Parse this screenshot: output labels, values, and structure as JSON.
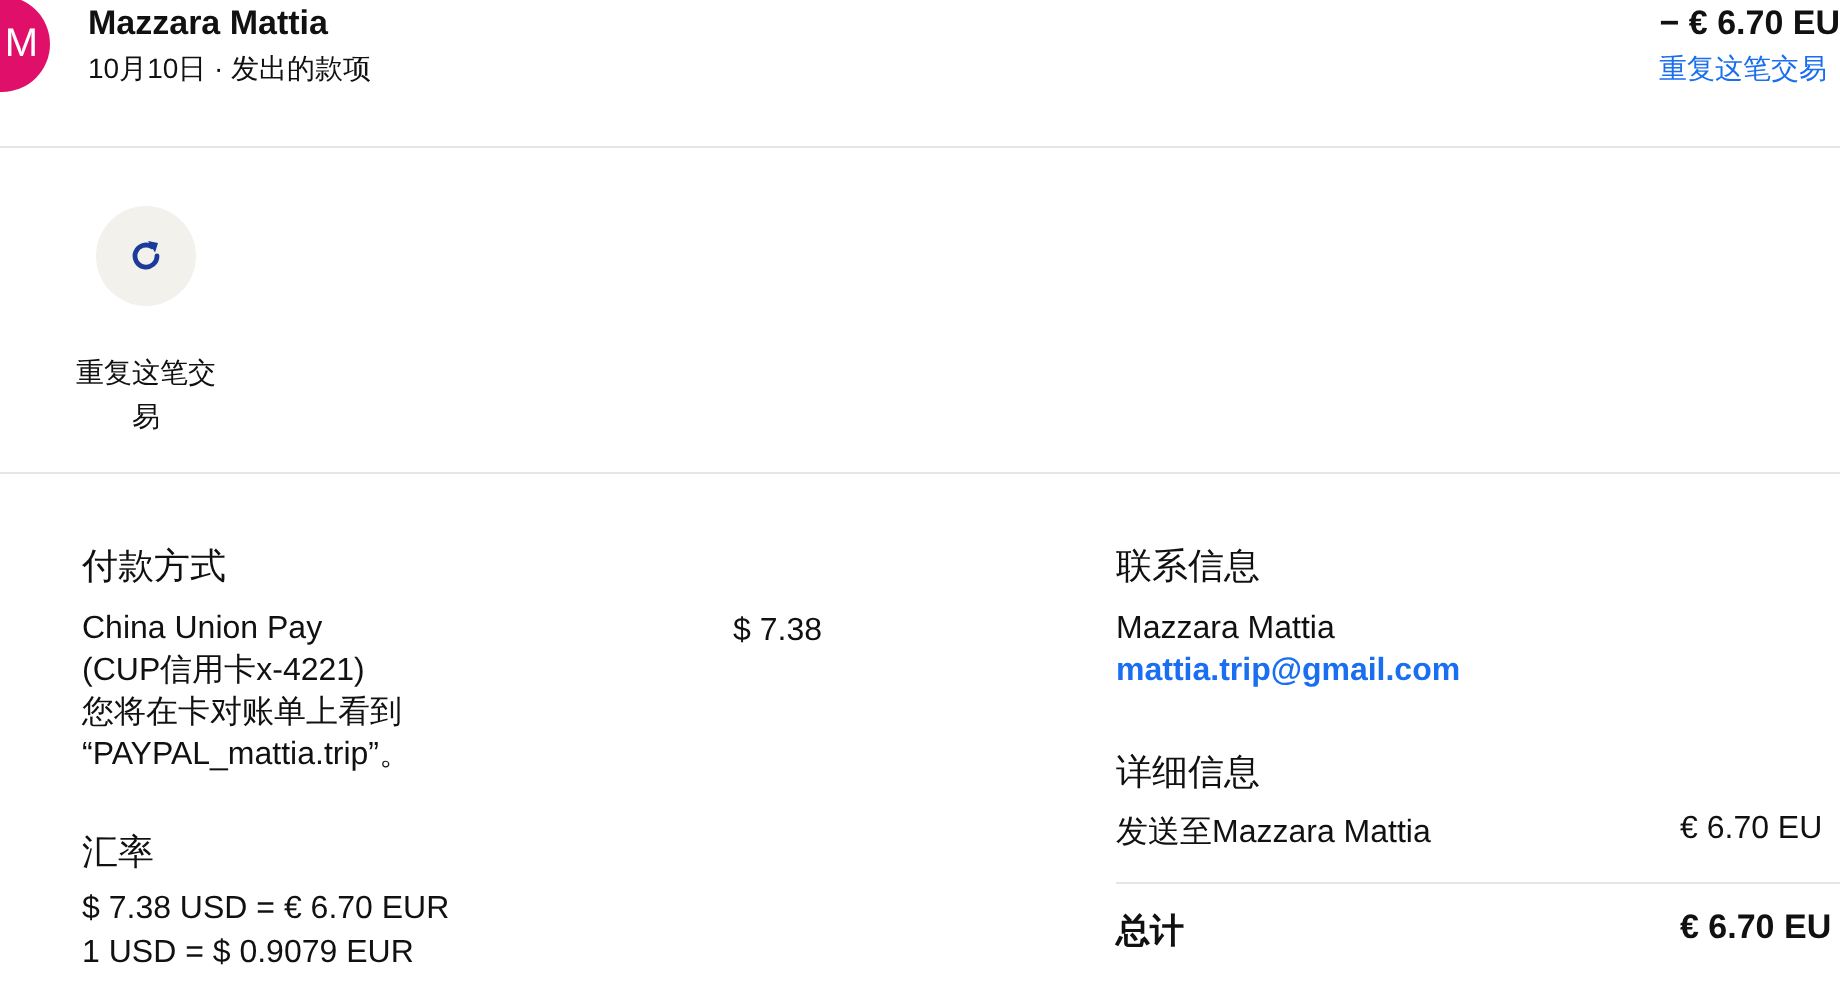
{
  "header": {
    "avatar": "M",
    "name": "Mazzara Mattia",
    "subtitle": "10月10日 · 发出的款项",
    "amount": "− € 6.70 EU",
    "repeat_link": "重复这笔交易"
  },
  "actions": [
    {
      "kind": "repeat",
      "label": "重复这笔交易"
    }
  ],
  "payment_method": {
    "title": "付款方式",
    "lines": [
      "China Union Pay",
      "(CUP信用卡x-4221)",
      "您将在卡对账单上看到",
      "“PAYPAL_mattia.trip”。"
    ],
    "amount": "$ 7.38"
  },
  "exchange_rate": {
    "title": "汇率",
    "lines": [
      "$ 7.38 USD = € 6.70 EUR",
      "1 USD = $ 0.9079 EUR"
    ]
  },
  "contact": {
    "title": "联系信息",
    "name": "Mazzara Mattia",
    "email": "mattia.trip@gmail.com"
  },
  "details": {
    "title": "详细信息",
    "rows": [
      {
        "label": "发送至Mazzara Mattia",
        "amount": "€ 6.70 EU"
      }
    ],
    "total": {
      "label": "总计",
      "amount": "€ 6.70 EU"
    }
  }
}
